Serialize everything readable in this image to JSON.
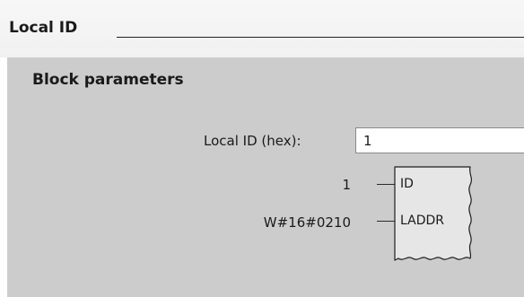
{
  "section": {
    "title": "Local ID"
  },
  "panel": {
    "title": "Block parameters"
  },
  "local_id_field": {
    "label": "Local ID (hex):",
    "value": "1"
  },
  "block": {
    "pins": [
      {
        "name": "ID",
        "value": "1"
      },
      {
        "name": "LADDR",
        "value": "W#16#0210"
      }
    ]
  }
}
